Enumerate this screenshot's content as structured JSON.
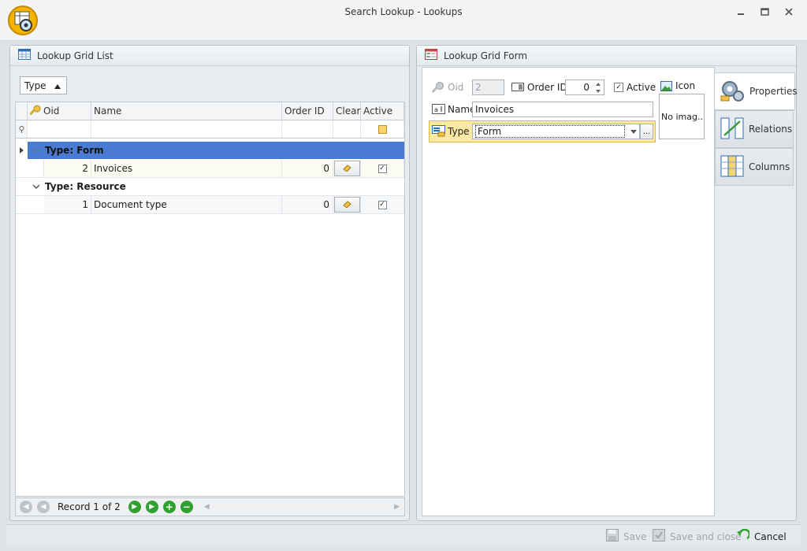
{
  "window": {
    "title": "Search Lookup - Lookups",
    "minimize_icon": "minimize-icon",
    "restore_icon": "restore-icon",
    "close_icon": "close-icon"
  },
  "left_panel": {
    "title": "Lookup Grid List",
    "group_chip": "Type",
    "columns": [
      "Oid",
      "Name",
      "Order ID",
      "Clear",
      "Active"
    ],
    "groups": [
      {
        "label": "Type: Form",
        "rows": [
          {
            "oid": "2",
            "name": "Invoices",
            "order_id": "0",
            "active": true
          }
        ]
      },
      {
        "label": "Type: Resource",
        "rows": [
          {
            "oid": "1",
            "name": "Document type",
            "order_id": "0",
            "active": true
          }
        ]
      }
    ],
    "navigator": {
      "record_text": "Record 1 of 2"
    }
  },
  "right_panel": {
    "title": "Lookup Grid Form",
    "fields": {
      "oid_label": "Oid",
      "oid_value": "2",
      "order_label": "Order ID",
      "order_value": "0",
      "active_label": "Active",
      "active_checked": true,
      "icon_label": "Icon",
      "icon_placeholder": "No imag...",
      "name_label": "Name",
      "name_value": "Invoices",
      "type_label": "Type",
      "type_value": "Form",
      "ellipsis": "..."
    },
    "tabs": [
      "Properties",
      "Relations",
      "Columns"
    ],
    "active_tab": "Properties"
  },
  "bottom_bar": {
    "save": "Save",
    "save_close": "Save and close",
    "cancel": "Cancel"
  },
  "colors": {
    "selected_group": "#4a7bd3",
    "highlight_field": "#fde9a2",
    "nav_green": "#2fa12f"
  }
}
